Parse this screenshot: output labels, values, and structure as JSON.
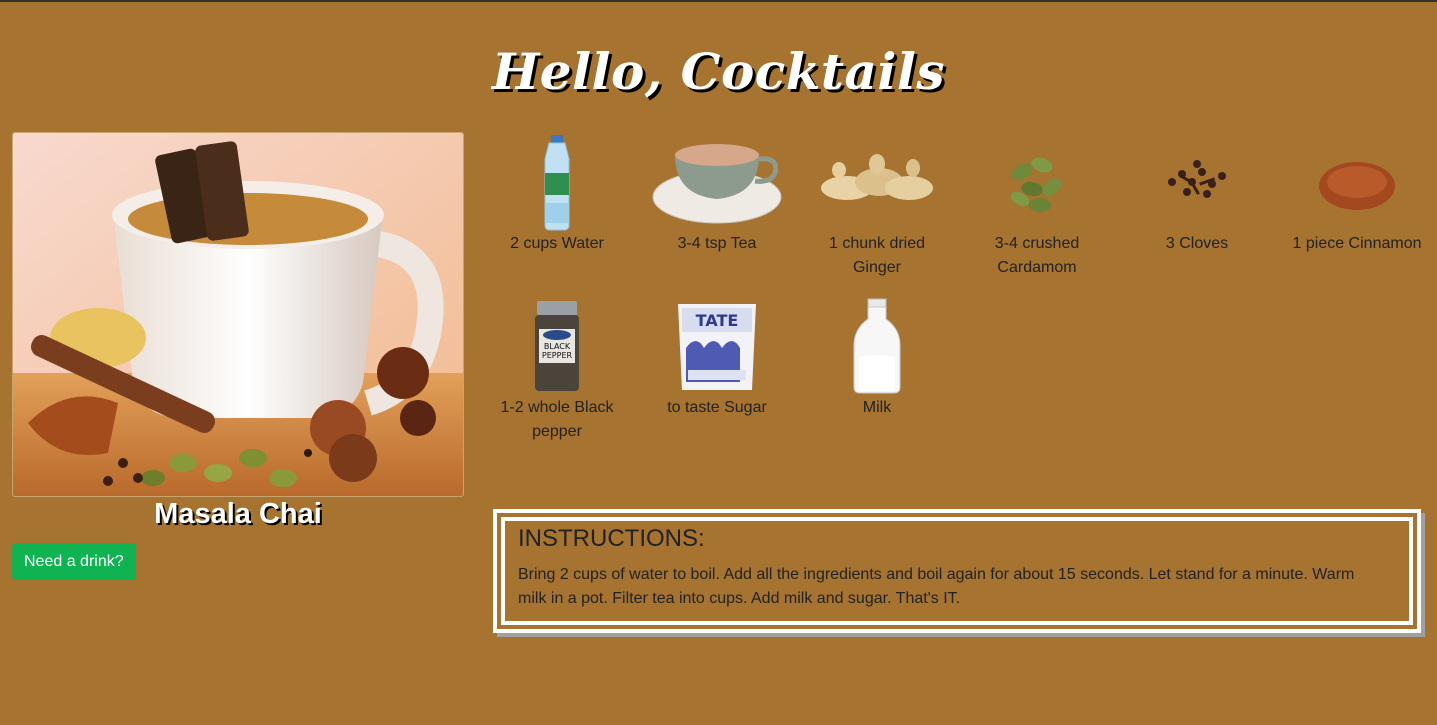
{
  "header": {
    "title": "Hello, Cocktails"
  },
  "drink": {
    "name": "Masala Chai",
    "button_label": "Need a drink?"
  },
  "ingredients": [
    {
      "label": "2 cups Water",
      "icon": "water-bottle-icon"
    },
    {
      "label": "3-4 tsp Tea",
      "icon": "tea-cup-icon"
    },
    {
      "label": "1 chunk dried Ginger",
      "icon": "ginger-icon"
    },
    {
      "label": "3-4 crushed Cardamom",
      "icon": "cardamom-icon"
    },
    {
      "label": "3 Cloves",
      "icon": "cloves-icon"
    },
    {
      "label": "1 piece Cinnamon",
      "icon": "cinnamon-icon"
    },
    {
      "label": "1-2 whole Black pepper",
      "icon": "pepper-jar-icon"
    },
    {
      "label": "to taste Sugar",
      "icon": "sugar-box-icon"
    },
    {
      "label": "Milk",
      "icon": "milk-bottle-icon"
    }
  ],
  "instructions": {
    "heading": "INSTRUCTIONS:",
    "text": "Bring 2 cups of water to boil. Add all the ingredients and boil again for about 15 seconds. Let stand for a minute. Warm milk in a pot. Filter tea into cups. Add milk and sugar. That's IT."
  },
  "colors": {
    "background": "#a67330",
    "button": "#0fb351",
    "title": "#ffffff"
  }
}
